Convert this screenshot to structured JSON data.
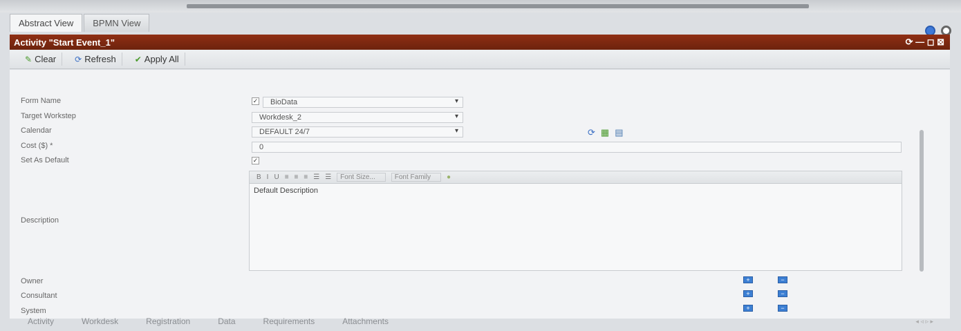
{
  "view_tabs": [
    "Abstract View",
    "BPMN View"
  ],
  "title": "Activity \"Start Event_1\"",
  "title_controls": "⟳ — ◻ ⊠",
  "toolbar": {
    "clear": "Clear",
    "refresh": "Refresh",
    "apply_all": "Apply All"
  },
  "form": {
    "form_name": {
      "label": "Form Name",
      "value": "BioData",
      "checked": true
    },
    "target_workstep": {
      "label": "Target Workstep",
      "value": "Workdesk_2"
    },
    "calendar": {
      "label": "Calendar",
      "value": "DEFAULT 24/7"
    },
    "cost": {
      "label": "Cost ($) *",
      "value": "0"
    },
    "set_as_default": {
      "label": "Set As Default",
      "checked": true
    },
    "description": {
      "label": "Description",
      "value": "Default Description"
    },
    "owner": {
      "label": "Owner"
    },
    "consultant": {
      "label": "Consultant"
    },
    "system": {
      "label": "System"
    }
  },
  "editor_toolbar": {
    "buttons": [
      "B",
      "I",
      "U",
      "≡",
      "≡",
      "≡",
      "☰",
      "☰"
    ],
    "font_size": "Font Size...",
    "font_family": "Font Family"
  },
  "bottom_tabs": [
    "Activity",
    "Workdesk",
    "Registration",
    "Data",
    "Requirements",
    "Attachments"
  ],
  "colors": {
    "title_bar": "#7a2810",
    "accent_blue": "#3c7fd3"
  }
}
